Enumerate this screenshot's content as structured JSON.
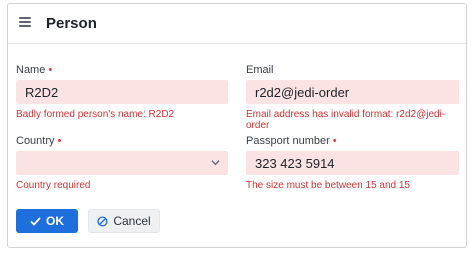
{
  "header": {
    "title": "Person",
    "menu_icon": "hamburger-icon"
  },
  "form": {
    "name": {
      "label": "Name",
      "required_mark": "•",
      "value": "R2D2",
      "error": "Badly formed person's name: R2D2"
    },
    "email": {
      "label": "Email",
      "value": "r2d2@jedi-order",
      "error": "Email address has invalid format: r2d2@jedi-order"
    },
    "country": {
      "label": "Country",
      "required_mark": "•",
      "value": "",
      "error": "Country required"
    },
    "passport": {
      "label": "Passport number",
      "required_mark": "•",
      "value": "323 423 5914",
      "error": "The size must be between 15 and 15"
    }
  },
  "actions": {
    "ok_label": "OK",
    "cancel_label": "Cancel"
  },
  "colors": {
    "primary": "#1e6fdc",
    "error": "#c93636",
    "invalid_field_bg": "#fbe3e3"
  }
}
